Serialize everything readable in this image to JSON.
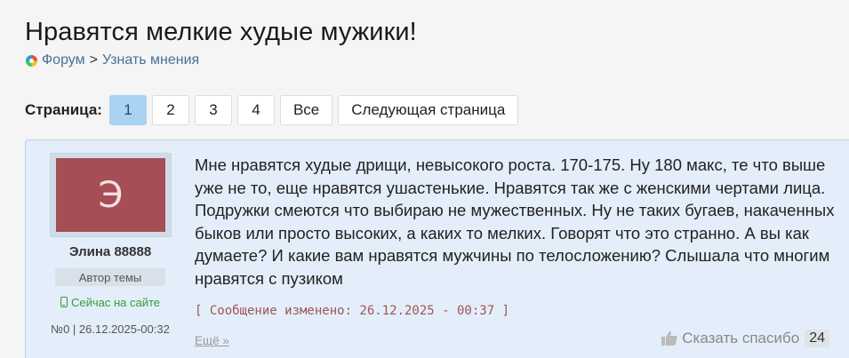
{
  "page": {
    "title": "Нравятся мелкие худые мужики!"
  },
  "breadcrumb": {
    "forum": "Форум",
    "separator": ">",
    "section": "Узнать мнения"
  },
  "pager": {
    "label": "Страница:",
    "pages": [
      "1",
      "2",
      "3",
      "4"
    ],
    "active": "1",
    "all": "Все",
    "next": "Следующая страница"
  },
  "post": {
    "avatar_letter": "Э",
    "avatar_color": "#a64e56",
    "author": "Элина 88888",
    "badge": "Автор темы",
    "online": "Сейчас на сайте",
    "meta": "№0 | 26.12.2025-00:32",
    "text": "Мне нравятся худые дрищи, невысокого роста. 170-175. Ну 180 макс, те что выше уже не то, еще нравятся ушастенькие. Нравятся так же с женскими чертами лица. Подружки смеются что выбираю не мужественных. Ну не таких бугаев, накаченных быков или просто высоких, а каких то мелких. Говорят что это странно. А вы как думаете? И какие вам нравятся мужчины по телосложению? Слышала что многим нравятся с пузиком",
    "edited": "[ Сообщение изменено: 26.12.2025 - 00:37 ]",
    "more": "Ещё »",
    "thanks_label": "Сказать спасибо",
    "thanks_count": "24"
  },
  "colors": {
    "accent": "#a9d2f3",
    "post_bg": "#e3eefa",
    "link": "#4a6f95",
    "online": "#3a9a3a"
  }
}
